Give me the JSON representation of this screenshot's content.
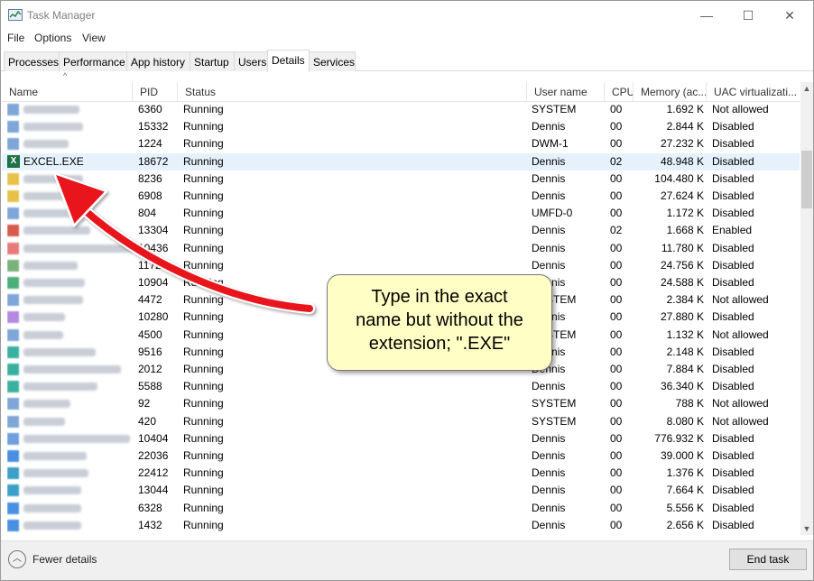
{
  "window": {
    "title": "Task Manager",
    "minimize_glyph": "—",
    "maximize_glyph": "☐",
    "close_glyph": "✕"
  },
  "menu": {
    "file": "File",
    "options": "Options",
    "view": "View"
  },
  "tabs": [
    {
      "label": "Processes"
    },
    {
      "label": "Performance"
    },
    {
      "label": "App history"
    },
    {
      "label": "Startup"
    },
    {
      "label": "Users"
    },
    {
      "label": "Details"
    },
    {
      "label": "Services"
    }
  ],
  "active_tab": "Details",
  "columns": {
    "name": "Name",
    "pid": "PID",
    "status": "Status",
    "user": "User name",
    "cpu": "CPU",
    "memory": "Memory (ac...",
    "uac": "UAC virtualizati..."
  },
  "rows": [
    {
      "pid": "6360",
      "status": "Running",
      "user": "SYSTEM",
      "cpu": "00",
      "mem": "1.692 K",
      "uac": "Not allowed",
      "icon_color": "#7fa6d8"
    },
    {
      "pid": "15332",
      "status": "Running",
      "user": "Dennis",
      "cpu": "00",
      "mem": "2.844 K",
      "uac": "Disabled",
      "icon_color": "#7fa6d8"
    },
    {
      "pid": "1224",
      "status": "Running",
      "user": "DWM-1",
      "cpu": "00",
      "mem": "27.232 K",
      "uac": "Disabled",
      "icon_color": "#7fa6d8"
    },
    {
      "name": "EXCEL.EXE",
      "pid": "18672",
      "status": "Running",
      "user": "Dennis",
      "cpu": "02",
      "mem": "48.948 K",
      "uac": "Disabled",
      "excel": true
    },
    {
      "pid": "8236",
      "status": "Running",
      "user": "Dennis",
      "cpu": "00",
      "mem": "104.480 K",
      "uac": "Disabled",
      "icon_color": "#e8c14a"
    },
    {
      "pid": "6908",
      "status": "Running",
      "user": "Dennis",
      "cpu": "00",
      "mem": "27.624 K",
      "uac": "Disabled",
      "icon_color": "#e8c14a"
    },
    {
      "pid": "804",
      "status": "Running",
      "user": "UMFD-0",
      "cpu": "00",
      "mem": "1.172 K",
      "uac": "Disabled",
      "icon_color": "#7fa6d8"
    },
    {
      "pid": "13304",
      "status": "Running",
      "user": "Dennis",
      "cpu": "02",
      "mem": "1.668 K",
      "uac": "Enabled",
      "icon_color": "#d75a4a"
    },
    {
      "pid": "10436",
      "status": "Running",
      "user": "Dennis",
      "cpu": "00",
      "mem": "11.780 K",
      "uac": "Disabled",
      "icon_color": "#e87a7a"
    },
    {
      "pid": "1172",
      "status": "Running",
      "user": "Dennis",
      "cpu": "00",
      "mem": "24.756 K",
      "uac": "Disabled",
      "icon_color": "#7ab37a"
    },
    {
      "pid": "10904",
      "status": "Running",
      "user": "Dennis",
      "cpu": "00",
      "mem": "24.588 K",
      "uac": "Disabled",
      "icon_color": "#4caf7a"
    },
    {
      "pid": "4472",
      "status": "Running",
      "user": "SYSTEM",
      "cpu": "00",
      "mem": "2.384 K",
      "uac": "Not allowed",
      "icon_color": "#7fa6d8"
    },
    {
      "pid": "10280",
      "status": "Running",
      "user": "Dennis",
      "cpu": "00",
      "mem": "27.880 K",
      "uac": "Disabled",
      "icon_color": "#b388e0"
    },
    {
      "pid": "4500",
      "status": "Running",
      "user": "SYSTEM",
      "cpu": "00",
      "mem": "1.132 K",
      "uac": "Not allowed",
      "icon_color": "#7fa6d8"
    },
    {
      "pid": "9516",
      "status": "Running",
      "user": "Dennis",
      "cpu": "00",
      "mem": "2.148 K",
      "uac": "Disabled",
      "icon_color": "#3ab0a0"
    },
    {
      "pid": "2012",
      "status": "Running",
      "user": "Dennis",
      "cpu": "00",
      "mem": "7.884 K",
      "uac": "Disabled",
      "icon_color": "#3ab0a0"
    },
    {
      "pid": "5588",
      "status": "Running",
      "user": "Dennis",
      "cpu": "00",
      "mem": "36.340 K",
      "uac": "Disabled",
      "icon_color": "#3ab0a0"
    },
    {
      "pid": "92",
      "status": "Running",
      "user": "SYSTEM",
      "cpu": "00",
      "mem": "788 K",
      "uac": "Not allowed",
      "icon_color": "#7fa6d8"
    },
    {
      "pid": "420",
      "status": "Running",
      "user": "SYSTEM",
      "cpu": "00",
      "mem": "8.080 K",
      "uac": "Not allowed",
      "icon_color": "#7fa6d8"
    },
    {
      "pid": "10404",
      "status": "Running",
      "user": "Dennis",
      "cpu": "00",
      "mem": "776.932 K",
      "uac": "Disabled",
      "icon_color": "#6f9fe0"
    },
    {
      "pid": "22036",
      "status": "Running",
      "user": "Dennis",
      "cpu": "00",
      "mem": "39.000 K",
      "uac": "Disabled",
      "icon_color": "#4a90e2"
    },
    {
      "pid": "22412",
      "status": "Running",
      "user": "Dennis",
      "cpu": "00",
      "mem": "1.376 K",
      "uac": "Disabled",
      "icon_color": "#3aa0c8"
    },
    {
      "pid": "13044",
      "status": "Running",
      "user": "Dennis",
      "cpu": "00",
      "mem": "7.664 K",
      "uac": "Disabled",
      "icon_color": "#3aa0c8"
    },
    {
      "pid": "6328",
      "status": "Running",
      "user": "Dennis",
      "cpu": "00",
      "mem": "5.556 K",
      "uac": "Disabled",
      "icon_color": "#4a90e2"
    },
    {
      "pid": "1432",
      "status": "Running",
      "user": "Dennis",
      "cpu": "00",
      "mem": "2.656 K",
      "uac": "Disabled",
      "icon_color": "#4a90e2"
    }
  ],
  "footer": {
    "fewer_details": "Fewer details",
    "end_task": "End task"
  },
  "callout": {
    "line1": "Type in the exact",
    "line2": "name but without the",
    "line3": "extension; \".EXE\""
  },
  "colors": {
    "selected_row": "#e5f1fb",
    "callout_bg": "#ffffc5",
    "arrow_red": "#e8141b",
    "excel_green": "#1e7145"
  }
}
